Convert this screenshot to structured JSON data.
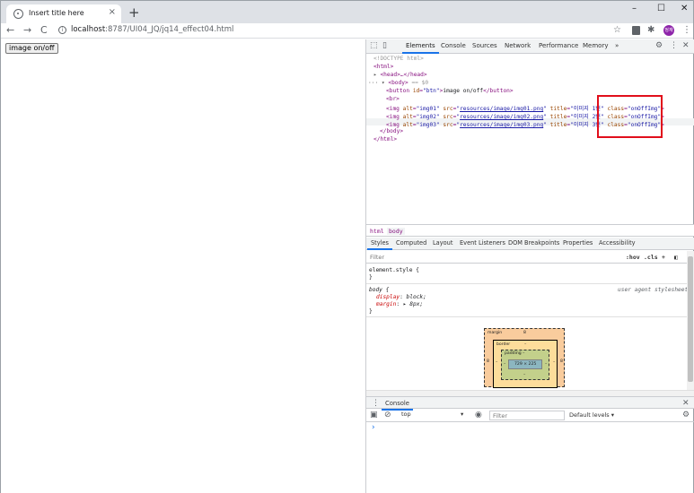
{
  "browser": {
    "tab_title": "Insert title here",
    "tab_close": "×",
    "new_tab": "+",
    "window_controls": {
      "minimize": "–",
      "maximize": "☐",
      "close": "✕"
    },
    "nav": {
      "back": "←",
      "forward": "→",
      "reload": "C"
    },
    "url_host": "localhost",
    "url_path": ":8787/UI04_JQ/jq14_effect04.html",
    "avatar_text": "정재"
  },
  "page": {
    "button_label": "image on/off"
  },
  "devtools": {
    "tabs": [
      "Elements",
      "Console",
      "Sources",
      "Network",
      "Performance",
      "Memory",
      "»"
    ],
    "active_tab": "Elements",
    "dom": {
      "doctype": "<!DOCTYPE html>",
      "html_open": "<html>",
      "head": "<head>…</head>",
      "body_open": "<body>",
      "body_marker": "== $0",
      "button": {
        "id": "btn",
        "text": "image on/off"
      },
      "br": "<br>",
      "images": [
        {
          "alt": "img01",
          "src": "resources/image/img01.png",
          "title": "이미지 1번",
          "class": "onOffImg"
        },
        {
          "alt": "img02",
          "src": "resources/image/img02.png",
          "title": "이미지 2번",
          "class": "onOffImg"
        },
        {
          "alt": "img03",
          "src": "resources/image/img03.png",
          "title": "이미지 3번",
          "class": "onOffImg"
        }
      ],
      "body_close": "</body>",
      "html_close": "</html>"
    },
    "breadcrumbs": [
      "html",
      "body"
    ],
    "sub_tabs": [
      "Styles",
      "Computed",
      "Layout",
      "Event Listeners",
      "DOM Breakpoints",
      "Properties",
      "Accessibility"
    ],
    "filter_placeholder": "Filter",
    "filter_tools": {
      "hov": ":hov",
      "cls": ".cls",
      "plus": "+"
    },
    "styles": {
      "element_style": "element.style {",
      "element_close": "}",
      "body_rule": "body {",
      "source": "user agent stylesheet",
      "display_prop": "display",
      "display_val": "block;",
      "margin_prop": "margin",
      "margin_val": "▸ 8px;",
      "body_close": "}"
    },
    "box_model": {
      "margin_label": "margin",
      "margin_value": "8",
      "border_label": "border",
      "border_value": "–",
      "padding_label": "padding –",
      "content": "729 × 225",
      "side_margin": "8",
      "dash": "–"
    },
    "drawer": {
      "label": "Console",
      "close": "✕"
    },
    "console_bar": {
      "context": "top",
      "filter_placeholder": "Filter",
      "levels": "Default levels ▾"
    },
    "prompt": "›"
  }
}
